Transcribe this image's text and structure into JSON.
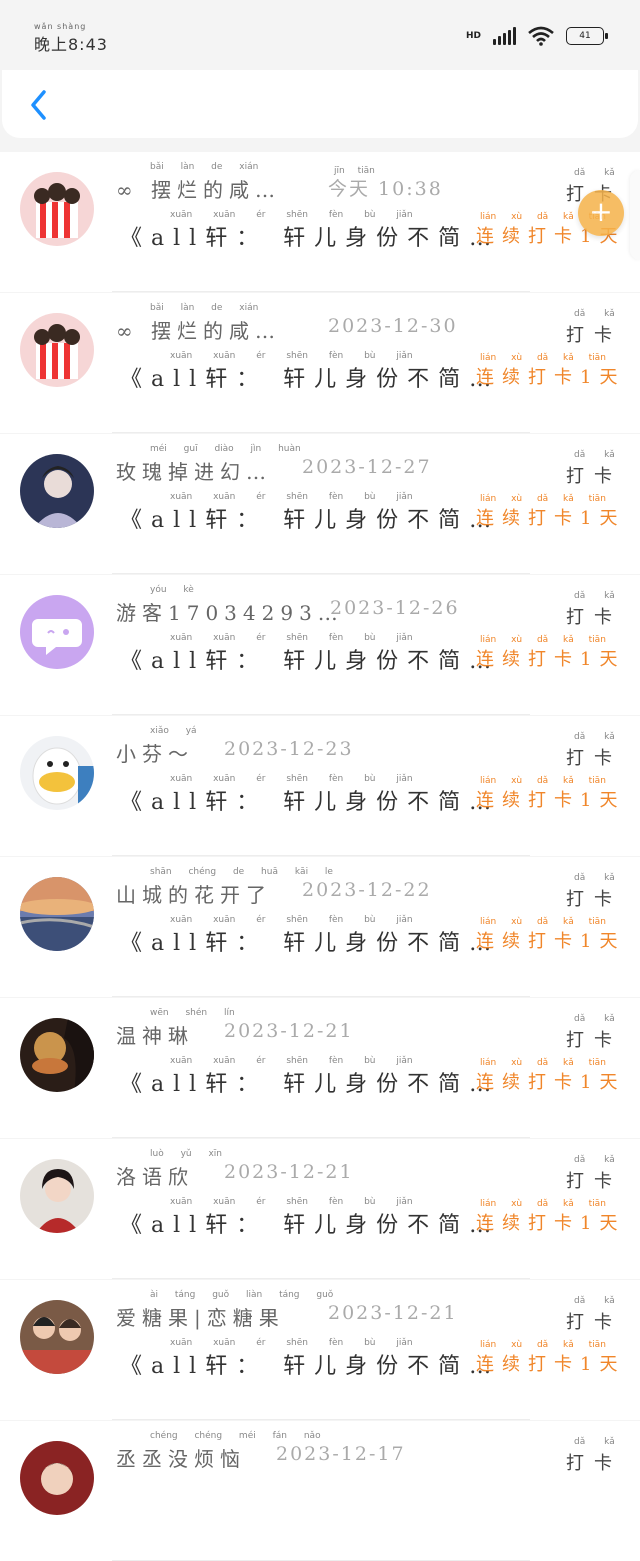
{
  "status": {
    "time": "晚上8:43",
    "time_ruby": "wǎn shàng",
    "network": "HD",
    "battery": "41"
  },
  "items": [
    {
      "name": "∞ 摆烂的咸…",
      "name_ruby": "bǎi làn de xián",
      "date": "今天 10:38",
      "date_ruby": "jīn tiān",
      "title": "《all轩： 轩儿身份不简…",
      "title_ruby": "xuān  xuān ér shēn fèn bù jiǎn",
      "streak": "连续打卡1天",
      "streak_ruby": "lián xù dǎ kǎ  tiān",
      "checkin": "打卡",
      "checkin_ruby": "dǎ kǎ",
      "avatar": "popcorn-avatar"
    },
    {
      "name": "∞ 摆烂的咸…",
      "name_ruby": "bǎi làn de xián",
      "date": "2023-12-30",
      "date_ruby": "",
      "title": "《all轩： 轩儿身份不简…",
      "title_ruby": "xuān  xuān ér shēn fèn bù jiǎn",
      "streak": "连续打卡1天",
      "streak_ruby": "lián xù dǎ kǎ  tiān",
      "checkin": "打卡",
      "checkin_ruby": "dǎ kǎ",
      "avatar": "popcorn-avatar"
    },
    {
      "name": "玫瑰掉进幻…",
      "name_ruby": "méi guī diào jìn huàn",
      "date": "2023-12-27",
      "date_ruby": "",
      "title": "《all轩： 轩儿身份不简…",
      "title_ruby": "xuān  xuān ér shēn fèn bù jiǎn",
      "streak": "连续打卡1天",
      "streak_ruby": "lián xù dǎ kǎ  tiān",
      "checkin": "打卡",
      "checkin_ruby": "dǎ kǎ",
      "avatar": "person-avatar"
    },
    {
      "name": "游客17034293…",
      "name_ruby": "yóu kè",
      "date": "2023-12-26",
      "date_ruby": "",
      "title": "《all轩： 轩儿身份不简…",
      "title_ruby": "xuān  xuān ér shēn fèn bù jiǎn",
      "streak": "连续打卡1天",
      "streak_ruby": "lián xù dǎ kǎ  tiān",
      "checkin": "打卡",
      "checkin_ruby": "dǎ kǎ",
      "avatar": "guest-avatar"
    },
    {
      "name": "小芬～",
      "name_ruby": "xiǎo yá",
      "date": "2023-12-23",
      "date_ruby": "",
      "title": "《all轩： 轩儿身份不简…",
      "title_ruby": "xuān  xuān ér shēn fèn bù jiǎn",
      "streak": "连续打卡1天",
      "streak_ruby": "lián xù dǎ kǎ  tiān",
      "checkin": "打卡",
      "checkin_ruby": "dǎ kǎ",
      "avatar": "duck-avatar"
    },
    {
      "name": "山城的花开了",
      "name_ruby": "shān chéng de huā kāi le",
      "date": "2023-12-22",
      "date_ruby": "",
      "title": "《all轩： 轩儿身份不简…",
      "title_ruby": "xuān  xuān ér shēn fèn bù jiǎn",
      "streak": "连续打卡1天",
      "streak_ruby": "lián xù dǎ kǎ  tiān",
      "checkin": "打卡",
      "checkin_ruby": "dǎ kǎ",
      "avatar": "sunset-avatar"
    },
    {
      "name": "温神琳",
      "name_ruby": "wēn shén lín",
      "date": "2023-12-21",
      "date_ruby": "",
      "title": "《all轩： 轩儿身份不简…",
      "title_ruby": "xuān  xuān ér shēn fèn bù jiǎn",
      "streak": "连续打卡1天",
      "streak_ruby": "lián xù dǎ kǎ  tiān",
      "checkin": "打卡",
      "checkin_ruby": "dǎ kǎ",
      "avatar": "candle-avatar"
    },
    {
      "name": "洛语欣",
      "name_ruby": "luò yǔ xīn",
      "date": "2023-12-21",
      "date_ruby": "",
      "title": "《all轩： 轩儿身份不简…",
      "title_ruby": "xuān  xuān ér shēn fèn bù jiǎn",
      "streak": "连续打卡1天",
      "streak_ruby": "lián xù dǎ kǎ  tiān",
      "checkin": "打卡",
      "checkin_ruby": "dǎ kǎ",
      "avatar": "girl-avatar"
    },
    {
      "name": "爱糖果|恋糖果",
      "name_ruby": "ài táng guǒ  liàn táng guǒ",
      "date": "2023-12-21",
      "date_ruby": "",
      "title": "《all轩： 轩儿身份不简…",
      "title_ruby": "xuān  xuān ér shēn fèn bù jiǎn",
      "streak": "连续打卡1天",
      "streak_ruby": "lián xù dǎ kǎ  tiān",
      "checkin": "打卡",
      "checkin_ruby": "dǎ kǎ",
      "avatar": "couple-avatar"
    },
    {
      "name": "丞丞没烦恼",
      "name_ruby": "chéng chéng méi fán nǎo",
      "date": "2023-12-17",
      "date_ruby": "",
      "title": "",
      "title_ruby": "",
      "streak": "",
      "streak_ruby": "",
      "checkin": "打卡",
      "checkin_ruby": "dǎ kǎ",
      "avatar": "boy-avatar"
    }
  ],
  "colors": {
    "accent": "#f0862a",
    "back": "#1e90ff",
    "float": "#f5b24a"
  }
}
